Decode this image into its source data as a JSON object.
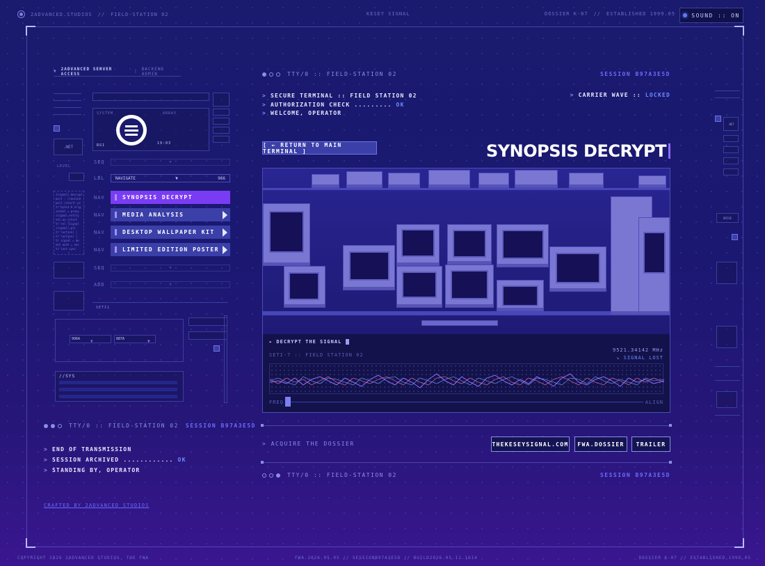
{
  "topbar": {
    "studio": "2ADVANCED.STUDIOS",
    "separator": "//",
    "station": "FIELD-STATION 02",
    "center": "KESEY SIGNAL",
    "right_dossier": "DOSSIER K-07",
    "right_sep": "//",
    "right_established": "ESTABLISHED 1999.05",
    "sound_label": "SOUND :: ON"
  },
  "left_panel": {
    "server_access": "2ADVANCED SERVER ACCESS",
    "backend_admin": "BACKEND ADMIN",
    "system_label": "SYSTEM",
    "array_label": "ARRAY",
    "rs_label": "RS1",
    "time": "19:03",
    "net_label": ".NET",
    "level_label": "LEVEL",
    "lbl_tag": "LBL",
    "navigate_label": "NAVIGATE",
    "navigate_val": "966",
    "nav_tag": "NAV",
    "nav_items": [
      {
        "label": "SYNOPSIS DECRYPT",
        "active": true
      },
      {
        "label": "MEDIA ANALYSIS",
        "active": false
      },
      {
        "label": "DESKTOP WALLPAPER KIT",
        "active": false
      },
      {
        "label": "LIMITED EDITION POSTER",
        "active": false
      }
    ],
    "seti_label": "SETI1",
    "sys_label": "//SYS",
    "val_a": "996A",
    "val_b": "887A"
  },
  "terminal_bottom": {
    "tty": "TTY/0 :: FIELD-STATION 02",
    "session": "SESSION B97A3E5D",
    "lines": [
      {
        "text": "END OF TRANSMISSION",
        "status": ""
      },
      {
        "text": "SESSION ARCHIVED ............",
        "status": "OK"
      },
      {
        "text": "STANDING BY, OPERATOR",
        "status": ""
      }
    ]
  },
  "crafted_by": "CRAFTED BY 2ADVANCED STUDIOS",
  "main": {
    "tty": "TTY/0 :: FIELD-STATION 02",
    "session": "SESSION B97A3E5D",
    "terminal_lines": [
      {
        "text": "SECURE TERMINAL :: FIELD STATION 02",
        "status": ""
      },
      {
        "text": "AUTHORIZATION CHECK .........",
        "status": "OK"
      },
      {
        "text": "WELCOME, OPERATOR",
        "status": ""
      }
    ],
    "carrier_wave": "CARRIER WAVE ::",
    "carrier_status": "LOCKED",
    "return_button": "[ ← RETURN TO MAIN TERMINAL ]",
    "title": "SYNOPSIS DECRYPT",
    "decrypt_label": "▸ DECRYPT THE SIGNAL",
    "seti_sub": "SETI-7 :: FIELD STATION 02",
    "frequency": "9521.34142 MHz",
    "signal_lost": "↘ SIGNAL LOST",
    "freq_label": "FREQ",
    "align_label": "ALIGN",
    "acquire": "> ACQUIRE THE DOSSIER",
    "links": [
      "THEKESEYSIGNAL.COM",
      "FWA.DOSSIER",
      "TRAILER"
    ],
    "bottom_tty": "TTY/0 :: FIELD-STATION 02",
    "bottom_session": "SESSION B97A3E5D"
  },
  "footer": {
    "copyright": "COPYRIGHT 2026 2ADVANCED STUDIOS, THE FWA",
    "center": "FWA.2026.05.05  //  SESSIONB97A3E5D  //  BUILD2026.05.11.1614",
    "right": "DOSSIER K-07  //  ESTABLISHED 1999.05"
  },
  "right_rail": {
    "net": ".NET",
    "drive": "DRIVE"
  },
  "colors": {
    "accent": "#7a3cf2",
    "nav": "#3b3fa8",
    "ok": "#6b8cff",
    "background": "#1a1a6e"
  }
}
